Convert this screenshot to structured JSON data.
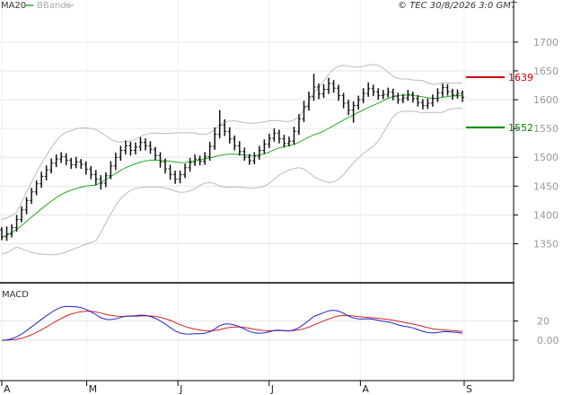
{
  "header": {
    "ma_label": "MA20",
    "bb_label": "BBands",
    "copyright": "© TEC 30/8/2026 3:0 GMT"
  },
  "colors": {
    "ma": "#22aa22",
    "bands": "#bbbbbb",
    "price": "#111111",
    "resistance": "#cc0000",
    "support": "#008800",
    "macd": "#2222cc",
    "signal": "#cc2222",
    "grid": "#e6e6e6"
  },
  "chart_data": [
    {
      "type": "ohlc",
      "yticks": [
        1350,
        1400,
        1450,
        1500,
        1550,
        1600,
        1650,
        1700
      ],
      "ylim": [
        1290,
        1745
      ],
      "x_labels": [
        "A",
        "M",
        "J",
        "J",
        "A",
        "S"
      ],
      "x_label_days": [
        0,
        27,
        56,
        85,
        114,
        147
      ],
      "x_range": [
        0,
        157
      ],
      "levels": [
        {
          "name": "resistance",
          "value": 1639,
          "label": "1639"
        },
        {
          "name": "support",
          "value": 1552,
          "label": "1552"
        }
      ],
      "ohlc": [
        [
          1374,
          1362,
          1379,
          1356
        ],
        [
          1362,
          1367,
          1380,
          1355
        ],
        [
          1367,
          1378,
          1384,
          1361
        ],
        [
          1378,
          1392,
          1400,
          1371
        ],
        [
          1392,
          1409,
          1415,
          1387
        ],
        [
          1409,
          1425,
          1431,
          1401
        ],
        [
          1425,
          1440,
          1447,
          1419
        ],
        [
          1440,
          1454,
          1460,
          1434
        ],
        [
          1454,
          1467,
          1475,
          1447
        ],
        [
          1467,
          1478,
          1486,
          1460
        ],
        [
          1478,
          1490,
          1498,
          1472
        ],
        [
          1490,
          1497,
          1505,
          1483
        ],
        [
          1497,
          1501,
          1509,
          1490
        ],
        [
          1501,
          1495,
          1507,
          1486
        ],
        [
          1495,
          1487,
          1499,
          1480
        ],
        [
          1487,
          1492,
          1501,
          1481
        ],
        [
          1492,
          1488,
          1497,
          1480
        ],
        [
          1488,
          1479,
          1493,
          1470
        ],
        [
          1479,
          1470,
          1485,
          1462
        ],
        [
          1470,
          1462,
          1478,
          1452
        ],
        [
          1462,
          1455,
          1469,
          1444
        ],
        [
          1455,
          1468,
          1474,
          1448
        ],
        [
          1468,
          1485,
          1493,
          1462
        ],
        [
          1485,
          1500,
          1508,
          1478
        ],
        [
          1500,
          1512,
          1520,
          1494
        ],
        [
          1512,
          1520,
          1529,
          1505
        ],
        [
          1520,
          1512,
          1527,
          1503
        ],
        [
          1512,
          1518,
          1526,
          1505
        ],
        [
          1518,
          1526,
          1535,
          1511
        ],
        [
          1526,
          1520,
          1533,
          1512
        ],
        [
          1520,
          1514,
          1528,
          1506
        ],
        [
          1514,
          1503,
          1518,
          1495
        ],
        [
          1503,
          1492,
          1509,
          1482
        ],
        [
          1492,
          1480,
          1498,
          1472
        ],
        [
          1480,
          1470,
          1487,
          1461
        ],
        [
          1470,
          1462,
          1477,
          1454
        ],
        [
          1462,
          1470,
          1477,
          1455
        ],
        [
          1470,
          1482,
          1489,
          1464
        ],
        [
          1482,
          1491,
          1499,
          1475
        ],
        [
          1491,
          1497,
          1505,
          1485
        ],
        [
          1497,
          1493,
          1503,
          1486
        ],
        [
          1493,
          1501,
          1509,
          1487
        ],
        [
          1501,
          1519,
          1527,
          1494
        ],
        [
          1519,
          1540,
          1552,
          1513
        ],
        [
          1540,
          1556,
          1582,
          1533
        ],
        [
          1556,
          1545,
          1566,
          1537
        ],
        [
          1545,
          1532,
          1552,
          1524
        ],
        [
          1532,
          1520,
          1538,
          1512
        ],
        [
          1520,
          1510,
          1528,
          1503
        ],
        [
          1510,
          1500,
          1517,
          1494
        ],
        [
          1500,
          1494,
          1506,
          1487
        ],
        [
          1494,
          1502,
          1509,
          1488
        ],
        [
          1502,
          1512,
          1520,
          1496
        ],
        [
          1512,
          1523,
          1531,
          1506
        ],
        [
          1523,
          1533,
          1541,
          1516
        ],
        [
          1533,
          1542,
          1550,
          1527
        ],
        [
          1542,
          1532,
          1548,
          1524
        ],
        [
          1532,
          1524,
          1539,
          1517
        ],
        [
          1524,
          1528,
          1536,
          1519
        ],
        [
          1528,
          1545,
          1553,
          1522
        ],
        [
          1545,
          1567,
          1575,
          1539
        ],
        [
          1567,
          1588,
          1598,
          1561
        ],
        [
          1588,
          1605,
          1614,
          1581
        ],
        [
          1605,
          1622,
          1645,
          1598
        ],
        [
          1622,
          1610,
          1628,
          1601
        ],
        [
          1610,
          1618,
          1627,
          1603
        ],
        [
          1618,
          1628,
          1638,
          1610
        ],
        [
          1628,
          1620,
          1634,
          1612
        ],
        [
          1620,
          1607,
          1626,
          1598
        ],
        [
          1607,
          1594,
          1612,
          1585
        ],
        [
          1594,
          1582,
          1600,
          1573
        ],
        [
          1582,
          1590,
          1597,
          1560
        ],
        [
          1590,
          1600,
          1607,
          1583
        ],
        [
          1600,
          1611,
          1620,
          1594
        ],
        [
          1611,
          1619,
          1630,
          1605
        ],
        [
          1619,
          1614,
          1626,
          1606
        ],
        [
          1614,
          1607,
          1620,
          1600
        ],
        [
          1607,
          1609,
          1617,
          1601
        ],
        [
          1609,
          1613,
          1621,
          1604
        ],
        [
          1613,
          1606,
          1619,
          1599
        ],
        [
          1606,
          1600,
          1612,
          1593
        ],
        [
          1600,
          1603,
          1610,
          1594
        ],
        [
          1603,
          1609,
          1617,
          1598
        ],
        [
          1609,
          1602,
          1614,
          1595
        ],
        [
          1602,
          1595,
          1608,
          1588
        ],
        [
          1595,
          1590,
          1601,
          1583
        ],
        [
          1590,
          1594,
          1602,
          1584
        ],
        [
          1594,
          1602,
          1609,
          1588
        ],
        [
          1602,
          1612,
          1620,
          1596
        ],
        [
          1612,
          1621,
          1628,
          1605
        ],
        [
          1621,
          1614,
          1627,
          1607
        ],
        [
          1614,
          1608,
          1619,
          1600
        ],
        [
          1608,
          1611,
          1618,
          1602
        ],
        [
          1611,
          1604,
          1616,
          1596
        ]
      ]
    },
    {
      "type": "line",
      "title": "MACD",
      "yticks": [
        0,
        20
      ],
      "tick_labels": [
        "0.00",
        "20"
      ],
      "ylim": [
        -40,
        55
      ],
      "series": []
    }
  ]
}
